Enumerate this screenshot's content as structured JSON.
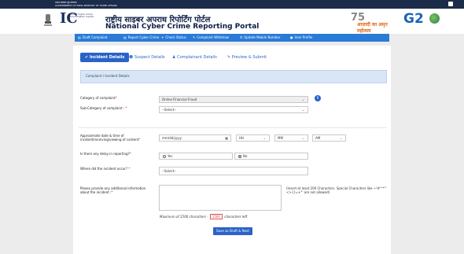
{
  "gov_bar": {
    "text_line1": "भारत सरकार  गृह मंत्रालय",
    "text_line2": "GOVERNMENT OF INDIA  MINISTRY OF HOME AFFAIRS"
  },
  "header": {
    "i4c_big": "IC",
    "i4c_small": "Indian Cyber Crime Coordination Centre",
    "title_hindi": "राष्ट्रीय साइबर अपराध रिपोर्टिंग पोर्टल",
    "title_english": "National Cyber Crime Reporting Portal",
    "azadi_number": "75",
    "azadi_text": "आज़ादी का अमृत महोत्सव",
    "g20": "G2"
  },
  "nav": [
    {
      "label": "Draft Complaint",
      "icon": "document-icon"
    },
    {
      "label": "Report Cyber Crime",
      "icon": "document-icon"
    },
    {
      "label": "Check Status",
      "icon": "star-icon"
    },
    {
      "label": "Complaint Withdraw",
      "icon": "edit-icon"
    },
    {
      "label": "Update Mobile Number",
      "icon": "phone-icon"
    },
    {
      "label": "User Profile",
      "icon": "user-icon"
    }
  ],
  "tabs": [
    {
      "label": "Incident Details",
      "icon": "check-icon"
    },
    {
      "label": "Suspect Details",
      "icon": "users-icon"
    },
    {
      "label": "Complainant Details",
      "icon": "person-icon"
    },
    {
      "label": "Preview & Submit",
      "icon": "edit-icon"
    }
  ],
  "section_title": "Complaint / Incident Details",
  "form": {
    "category_label": "Category of complaint",
    "category_value": "Online Financial Fraud",
    "subcategory_label": "Sub-Category of complaint :",
    "subcategory_value": "--Select--",
    "datetime_label": "Approximate date & time of incident/receiving/viewing of content",
    "date_placeholder": "mm/dd/yyyy",
    "hour_value": "HH",
    "minute_value": "MM",
    "ampm_value": "AM",
    "delay_label": "Is there any delay in reporting?",
    "delay_options": [
      "Yes",
      "No"
    ],
    "delay_selected": "No",
    "where_label": "Where did the incident occur?",
    "where_value": "--Select--",
    "info_label": "Please provide any additional information about the incident :",
    "hint_text": "(Insert at least 200 Characters. Special Characters like ~!#^*'\"<>{}=+\"' are not allowed)",
    "counter_prefix": "Maximum of 1500 characters -",
    "counter_value": "1500",
    "counter_suffix": "characters left"
  },
  "save_button": "Save as Draft & Next",
  "colors": {
    "primary": "#2a63c8",
    "nav": "#2a7bd8",
    "govbar": "#1b2b4a"
  }
}
